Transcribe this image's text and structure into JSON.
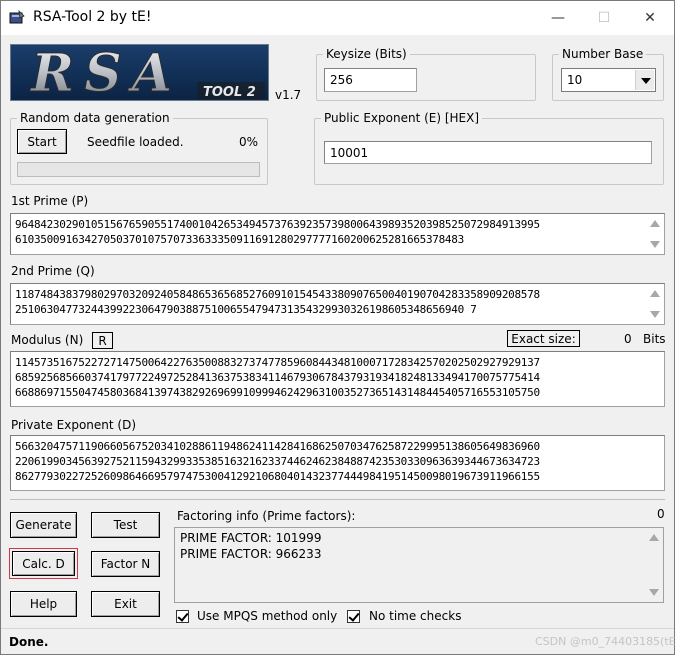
{
  "window": {
    "title": "RSA-Tool 2 by tE!",
    "minimize_glyph": "—",
    "maximize_glyph": "☐",
    "close_glyph": "✕"
  },
  "logo": {
    "text": "RSA",
    "subtext": "TOOL 2",
    "version": "v1.7"
  },
  "keysize": {
    "label": "Keysize (Bits)",
    "value": "256"
  },
  "number_base": {
    "label": "Number Base",
    "selected": "10"
  },
  "random": {
    "label": "Random data generation",
    "start_label": "Start",
    "status": "Seedfile loaded.",
    "percent": "0%",
    "progress_fraction": 0
  },
  "public_exponent": {
    "label": "Public Exponent (E) [HEX]",
    "value": "10001"
  },
  "prime_p": {
    "label": "1st Prime (P)",
    "lines": [
      "96484230290105156765905517400104265349457376392357398006439893520398525072984913995",
      "61035009163427050370107570733633350911691280297777160200625281665378483"
    ]
  },
  "prime_q": {
    "label": "2nd Prime (Q)",
    "lines": [
      "11874843837980297032092405848653656852760910154543380907650040190704283358909208578",
      "25106304773244399223064790388751006554794731354329930326198605348656940 7"
    ]
  },
  "modulus": {
    "label": "Modulus (N)",
    "r_label": "R",
    "exact_size_label": "Exact size:",
    "exact_size_value": "0",
    "bits_label": "Bits",
    "lines": [
      "11457351675227271475006422763500883273747785960844348100071728342570202502927929137",
      "68592568566037417977224972528413637538341146793067843793193418248133494170075775414",
      "66886971550474580368413974382926969910999462429631003527365143148445405716553105750"
    ]
  },
  "private_exponent": {
    "label": "Private Exponent (D)",
    "lines": [
      "56632047571190660567520341028861194862411428416862507034762587229995138605649836960",
      "22061990345639275211594329933538516321623374462462384887423530330963639344673634723",
      "86277930227252609864669579747530041292106804014323774449841951450098019673911966155"
    ]
  },
  "buttons": {
    "generate": "Generate",
    "test": "Test",
    "calc_d": "Calc. D",
    "factor_n": "Factor N",
    "help": "Help",
    "exit": "Exit"
  },
  "factoring": {
    "label": "Factoring info (Prime factors):",
    "count": "0",
    "lines": [
      "PRIME FACTOR: 101999",
      "PRIME FACTOR: 966233"
    ],
    "mpqs_label": "Use MPQS method only",
    "no_time_label": "No time checks"
  },
  "status": {
    "text": "Done."
  },
  "watermark": "CSDN @m0_74403185(tE)"
}
